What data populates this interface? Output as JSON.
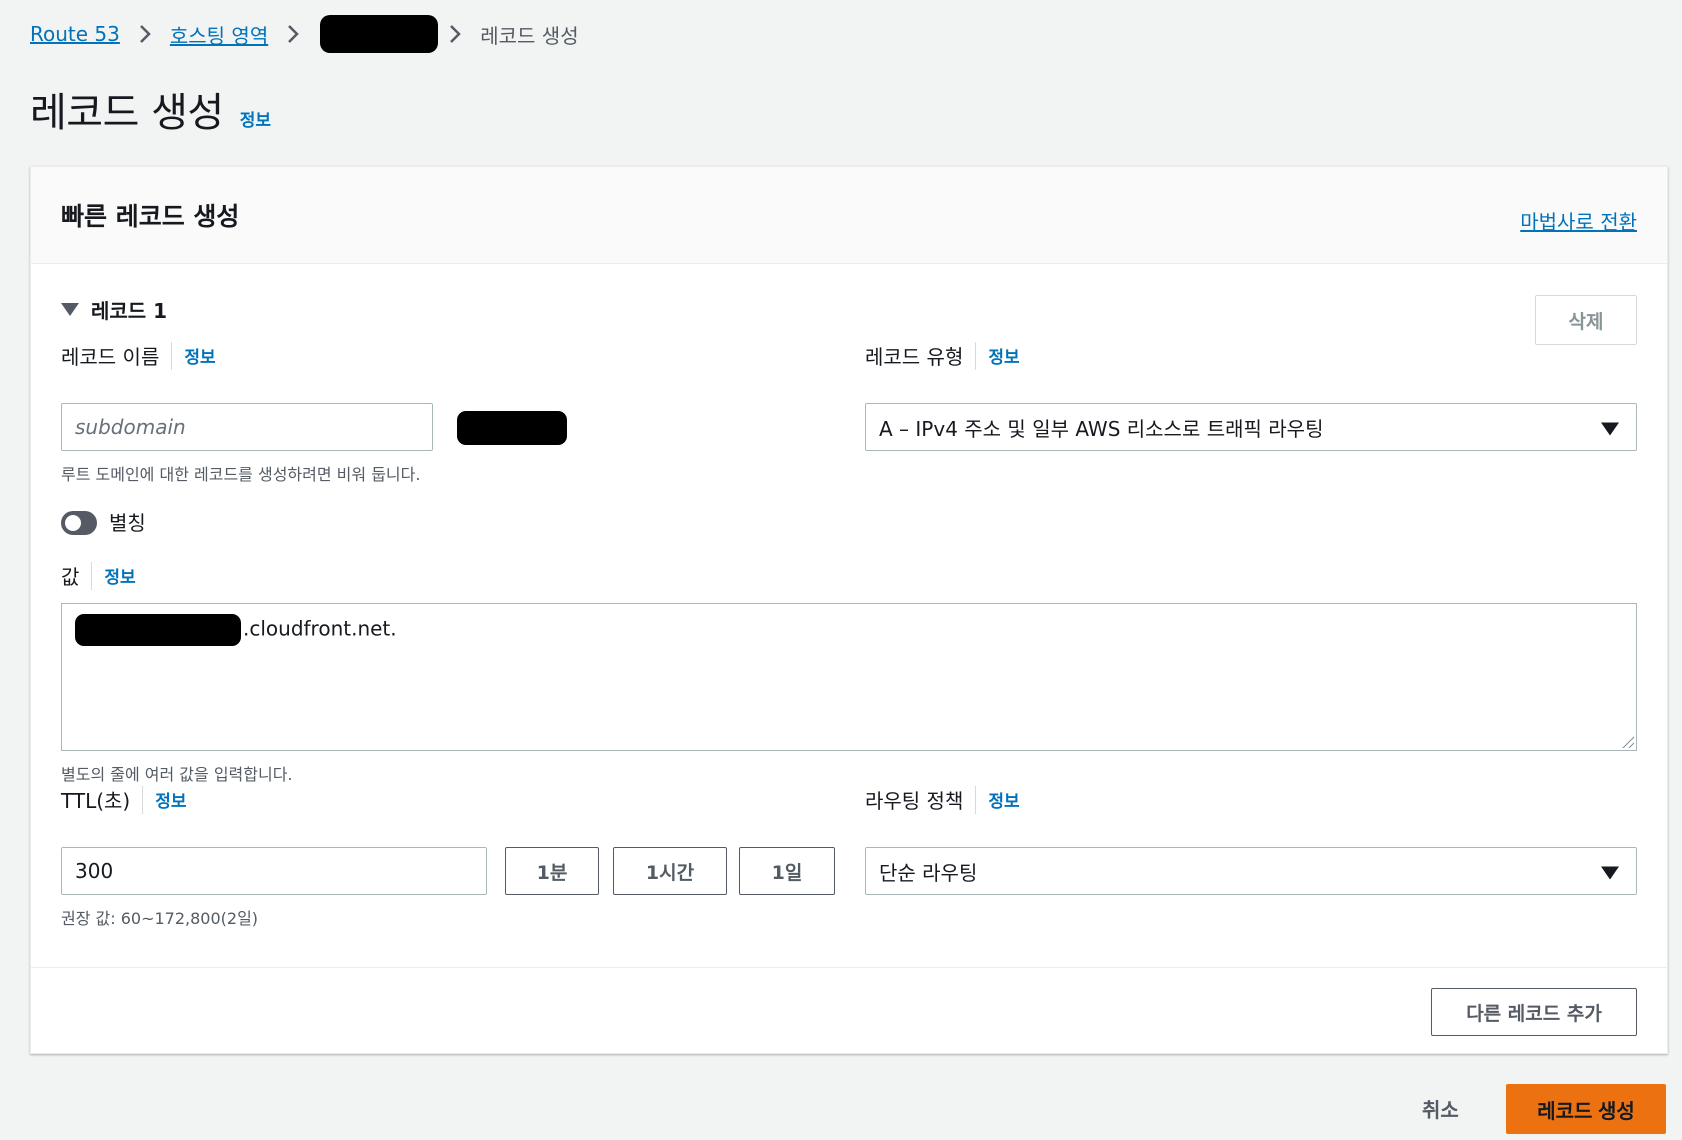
{
  "breadcrumb": {
    "route53": "Route 53",
    "hosted_zones": "호스팅 영역",
    "current": "레코드 생성"
  },
  "page": {
    "title": "레코드 생성",
    "info": "정보"
  },
  "panel": {
    "title": "빠른 레코드 생성",
    "wizard_link": "마법사로 전환",
    "record_heading": "레코드 1",
    "delete_label": "삭제"
  },
  "record_name": {
    "label": "레코드 이름",
    "info": "정보",
    "placeholder": "subdomain",
    "hint": "루트 도메인에 대한 레코드를 생성하려면 비워 둡니다."
  },
  "record_type": {
    "label": "레코드 유형",
    "info": "정보",
    "selected": "A – IPv4 주소 및 일부 AWS 리소스로 트래픽 라우팅"
  },
  "alias": {
    "label": "별칭",
    "enabled": false
  },
  "value": {
    "label": "값",
    "info": "정보",
    "text": ".cloudfront.net.",
    "hint": "별도의 줄에 여러 값을 입력합니다."
  },
  "ttl": {
    "label": "TTL(초)",
    "info": "정보",
    "value": "300",
    "hint": "권장 값: 60~172,800(2일)",
    "btn_1m": "1분",
    "btn_1h": "1시간",
    "btn_1d": "1일"
  },
  "routing": {
    "label": "라우팅 정책",
    "info": "정보",
    "selected": "단순 라우팅"
  },
  "footer": {
    "add_record": "다른 레코드 추가",
    "cancel": "취소",
    "create": "레코드 생성"
  },
  "colors": {
    "link": "#0073bb",
    "primary": "#ec7211",
    "background": "#f2f3f3"
  }
}
